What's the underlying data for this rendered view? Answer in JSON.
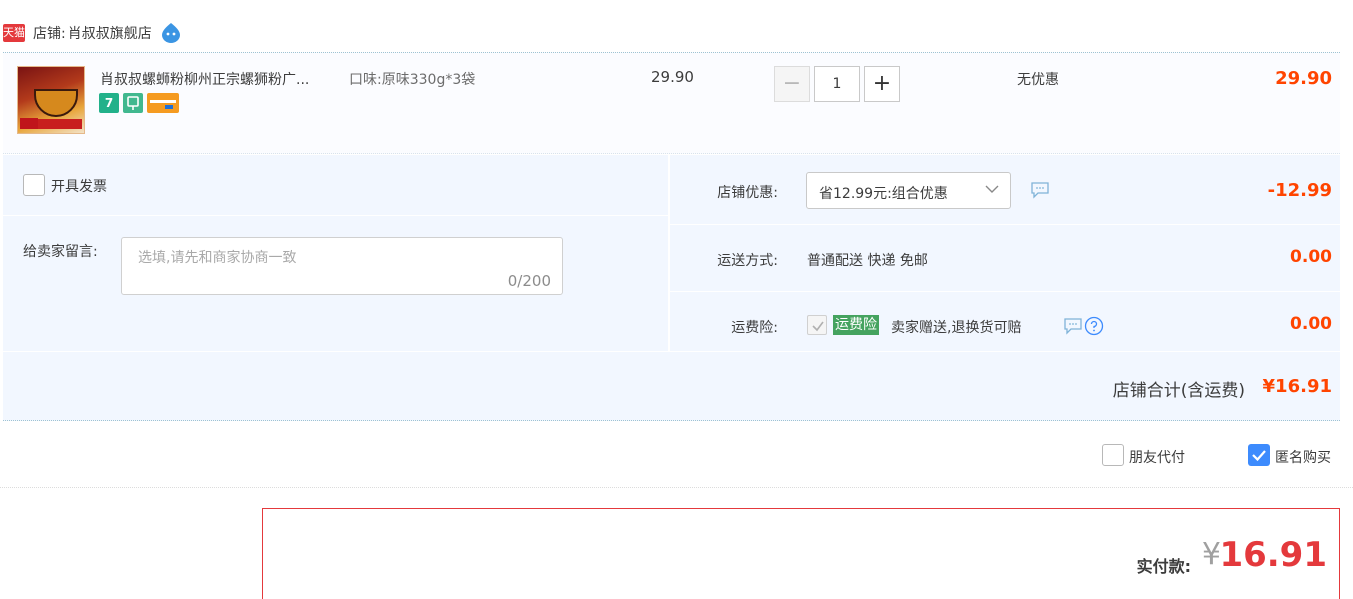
{
  "shop": {
    "badge": "天猫",
    "label": "店铺:",
    "name": "肖叔叔旗舰店",
    "chat_icon": "wangwang-icon"
  },
  "item": {
    "title": "肖叔叔螺蛳粉柳州正宗螺狮粉广...",
    "flavor": "口味:原味330g*3袋",
    "unit_price": "29.90",
    "quantity": "1",
    "minus": "−",
    "plus": "+",
    "discount": "无优惠",
    "subtotal": "29.90",
    "service_icons": [
      "7",
      "wheat-icon",
      "card-icon"
    ]
  },
  "invoice": {
    "label": "开具发票"
  },
  "message": {
    "label": "给卖家留言:",
    "placeholder": "选填,请先和商家协商一致",
    "count": "0/200"
  },
  "coupon": {
    "label": "店铺优惠:",
    "value": "省12.99元:组合优惠",
    "amount": "-12.99"
  },
  "shipping": {
    "label": "运送方式:",
    "value": "普通配送 快递 免邮",
    "amount": "0.00"
  },
  "insurance": {
    "label": "运费险:",
    "badge": "运费险",
    "text": "卖家赠送,退换货可赔",
    "amount": "0.00"
  },
  "shop_total": {
    "label": "店铺合计(含运费)",
    "value": "¥16.91"
  },
  "options": {
    "friend_pay": "朋友代付",
    "anonymous": "匿名购买"
  },
  "payment": {
    "label": "实付款:",
    "currency": "¥",
    "value": "16.91"
  },
  "colors": {
    "price_red": "#ff4400",
    "panel_bg": "#f2f7ff",
    "accent_blue": "#3d8bfd",
    "insurance_green": "#45a35f"
  }
}
